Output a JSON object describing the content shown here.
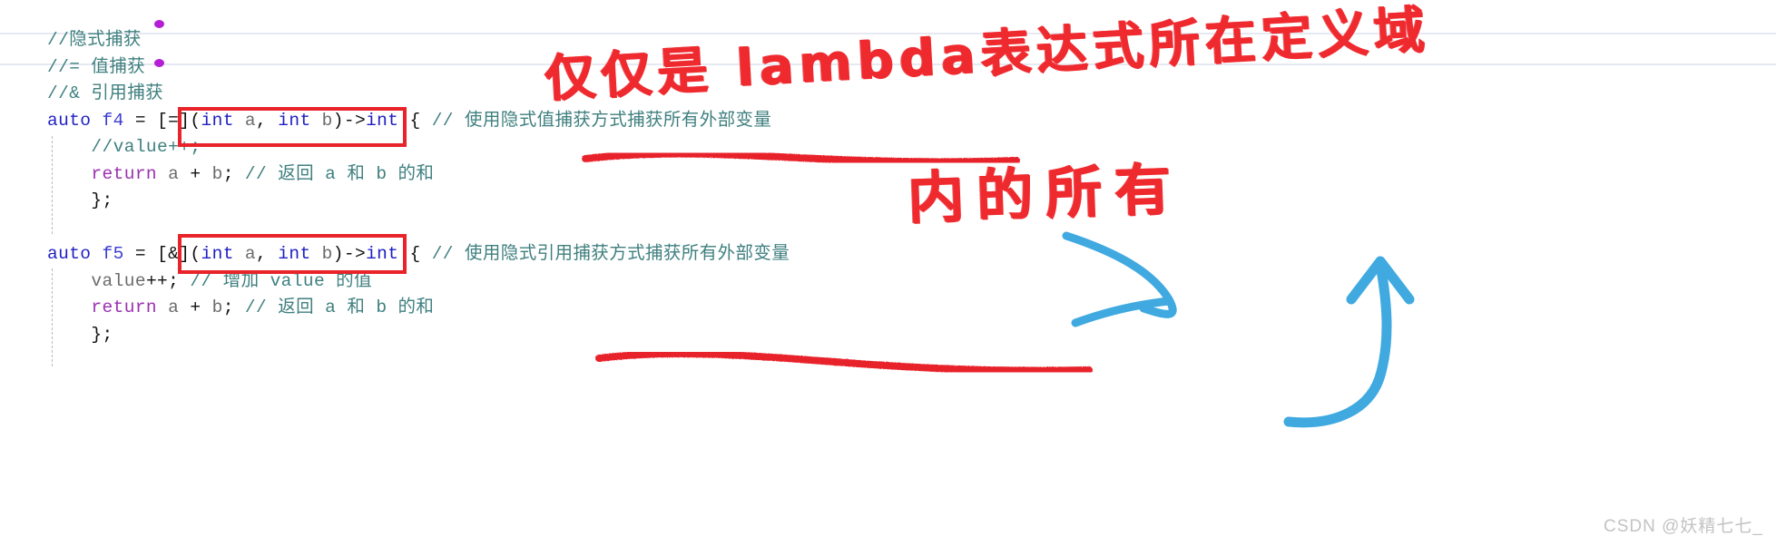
{
  "editor": {
    "language": "cpp",
    "lines": [
      {
        "indent": 0,
        "tokens": [
          {
            "cls": "cmt",
            "t": "//隐式捕获"
          }
        ]
      },
      {
        "indent": 0,
        "tokens": [
          {
            "cls": "cmt",
            "t": "//= 值捕获"
          }
        ]
      },
      {
        "indent": 0,
        "tokens": [
          {
            "cls": "cmt",
            "t": "//& 引用捕获"
          }
        ]
      },
      {
        "indent": 0,
        "tokens": [
          {
            "cls": "kw",
            "t": "auto"
          },
          {
            "cls": "pl",
            "t": " "
          },
          {
            "cls": "id",
            "t": "f4"
          },
          {
            "cls": "pl",
            "t": " = "
          },
          {
            "cls": "pl",
            "t": "[=]"
          },
          {
            "cls": "pl",
            "t": "("
          },
          {
            "cls": "kw",
            "t": "int"
          },
          {
            "cls": "var",
            "t": " a"
          },
          {
            "cls": "pl",
            "t": ", "
          },
          {
            "cls": "kw",
            "t": "int"
          },
          {
            "cls": "var",
            "t": " b"
          },
          {
            "cls": "pl",
            "t": ")->"
          },
          {
            "cls": "kw",
            "t": "int"
          },
          {
            "cls": "pl",
            "t": " { "
          },
          {
            "cls": "cmt",
            "t": "// 使用隐式值捕获方式捕获所有外部变量"
          }
        ]
      },
      {
        "indent": 1,
        "tokens": [
          {
            "cls": "cmt",
            "t": "//value++;"
          }
        ]
      },
      {
        "indent": 1,
        "tokens": [
          {
            "cls": "kw2",
            "t": "return"
          },
          {
            "cls": "var",
            "t": " a "
          },
          {
            "cls": "pl",
            "t": "+"
          },
          {
            "cls": "var",
            "t": " b"
          },
          {
            "cls": "pl",
            "t": "; "
          },
          {
            "cls": "cmt",
            "t": "// 返回 a 和 b 的和"
          }
        ]
      },
      {
        "indent": 1,
        "tokens": [
          {
            "cls": "pl",
            "t": "};"
          }
        ]
      },
      {
        "indent": 0,
        "tokens": [
          {
            "cls": "pl",
            "t": ""
          }
        ]
      },
      {
        "indent": 0,
        "tokens": [
          {
            "cls": "kw",
            "t": "auto"
          },
          {
            "cls": "pl",
            "t": " "
          },
          {
            "cls": "id",
            "t": "f5"
          },
          {
            "cls": "pl",
            "t": " = "
          },
          {
            "cls": "pl",
            "t": "[&]"
          },
          {
            "cls": "pl",
            "t": "("
          },
          {
            "cls": "kw",
            "t": "int"
          },
          {
            "cls": "var",
            "t": " a"
          },
          {
            "cls": "pl",
            "t": ", "
          },
          {
            "cls": "kw",
            "t": "int"
          },
          {
            "cls": "var",
            "t": " b"
          },
          {
            "cls": "pl",
            "t": ")->"
          },
          {
            "cls": "kw",
            "t": "int"
          },
          {
            "cls": "pl",
            "t": " { "
          },
          {
            "cls": "cmt",
            "t": "// 使用隐式引用捕获方式捕获所有外部变量"
          }
        ]
      },
      {
        "indent": 1,
        "tokens": [
          {
            "cls": "var",
            "t": "value"
          },
          {
            "cls": "pl",
            "t": "++; "
          },
          {
            "cls": "cmt",
            "t": "// 增加 value 的值"
          }
        ]
      },
      {
        "indent": 1,
        "tokens": [
          {
            "cls": "kw2",
            "t": "return"
          },
          {
            "cls": "var",
            "t": " a "
          },
          {
            "cls": "pl",
            "t": "+"
          },
          {
            "cls": "var",
            "t": " b"
          },
          {
            "cls": "pl",
            "t": "; "
          },
          {
            "cls": "cmt",
            "t": "// 返回 a 和 b 的和"
          }
        ]
      },
      {
        "indent": 1,
        "tokens": [
          {
            "cls": "pl",
            "t": "};"
          }
        ]
      }
    ]
  },
  "annotations": {
    "handwriting_line1": "仅仅是 lambda表达式所在定义域",
    "handwriting_line2": "内的所有",
    "red_box_1_target": "[=](int a, int b)->int",
    "red_box_2_target": "[&](int a, int b)->int",
    "underline_1_target": "// 使用隐式值捕获方式捕获所有外部变量",
    "underline_2_target": "// 使用隐式引用捕获方式捕获所有外部变量",
    "arrow_blue_1": "points-from-handwriting-to-f5-line",
    "arrow_blue_2": "curved-up-arrow"
  },
  "colors": {
    "marker_red": "#ef2a2f",
    "box_red": "#e8232a",
    "arrow_blue": "#3fa9e0",
    "comment_teal": "#3f7f7f",
    "keyword_blue": "#1f1fc4",
    "keyword_purple": "#9b30b0",
    "watermark_gray": "#c3c3c3"
  },
  "watermark": {
    "text": "CSDN @妖精七七_"
  }
}
